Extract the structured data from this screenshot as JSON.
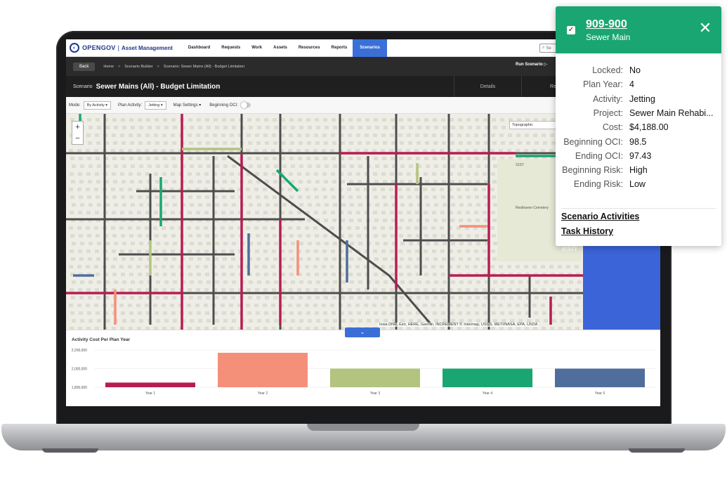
{
  "header": {
    "logo_text": "OPENGOV",
    "product": "Asset Management",
    "nav": [
      "Dashboard",
      "Requests",
      "Work",
      "Assets",
      "Resources",
      "Reports",
      "Scenarios"
    ],
    "active_nav": "Scenarios",
    "search_placeholder": "Se"
  },
  "breadcrumb": {
    "back_label": "Back",
    "items": [
      "Home",
      "Scenario Builder",
      "Scenario: Sewer Mains (All) - Budget Limitation"
    ],
    "run_label": "Run Scenario"
  },
  "title_bar": {
    "label": "Scenario",
    "title": "Sewer Mains (All) - Budget Limitation",
    "tabs": [
      "Details",
      "Re"
    ]
  },
  "toolbar": {
    "mode_label": "Mode:",
    "mode_value": "By Activity",
    "plan_label": "Plan Activity:",
    "plan_value": "Jetting",
    "map_settings": "Map Settings",
    "oci_label": "Beginning OCI:"
  },
  "map": {
    "basemap": "Topographic",
    "zoom_in": "+",
    "zoom_out": "−",
    "attribution": "Iowa DNR, Esri, HERE, Garmin, INCREMENT P, Intermap, USGS, METI/NASA, EPA, USDA",
    "esri_mark": "esri",
    "cemetery_label": "Resthaven Cemetery",
    "road_label": "31ST"
  },
  "chart_data": {
    "type": "bar",
    "title": "Activity Cost Per Plan Year",
    "categories": [
      "Year 1",
      "Year 2",
      "Year 3",
      "Year 4",
      "Year 5"
    ],
    "values": [
      1850000,
      2170000,
      2000000,
      2000000,
      2000000
    ],
    "colors": [
      "#b81c52",
      "#f4907a",
      "#b3c47e",
      "#1aa672",
      "#4f6e9c"
    ],
    "ylim": [
      1800000,
      2200000
    ],
    "yticks": [
      "2,200,000",
      "2,000,000",
      "1,800,000"
    ],
    "xlabel": "",
    "ylabel": ""
  },
  "popup": {
    "id": "909-900",
    "type": "Sewer Main",
    "props": [
      {
        "label": "Locked:",
        "value": "No"
      },
      {
        "label": "Plan Year:",
        "value": "4"
      },
      {
        "label": "Activity:",
        "value": "Jetting"
      },
      {
        "label": "Project:",
        "value": "Sewer Main Rehabi..."
      },
      {
        "label": "Cost:",
        "value": "$4,188.00"
      },
      {
        "label": "Beginning OCI:",
        "value": "98.5"
      },
      {
        "label": "Ending OCI:",
        "value": "97.43"
      },
      {
        "label": "Beginning Risk:",
        "value": "High"
      },
      {
        "label": "Ending Risk:",
        "value": "Low"
      }
    ],
    "links": [
      "Scenario Activities",
      "Task History"
    ],
    "accent": "#1aa672"
  }
}
